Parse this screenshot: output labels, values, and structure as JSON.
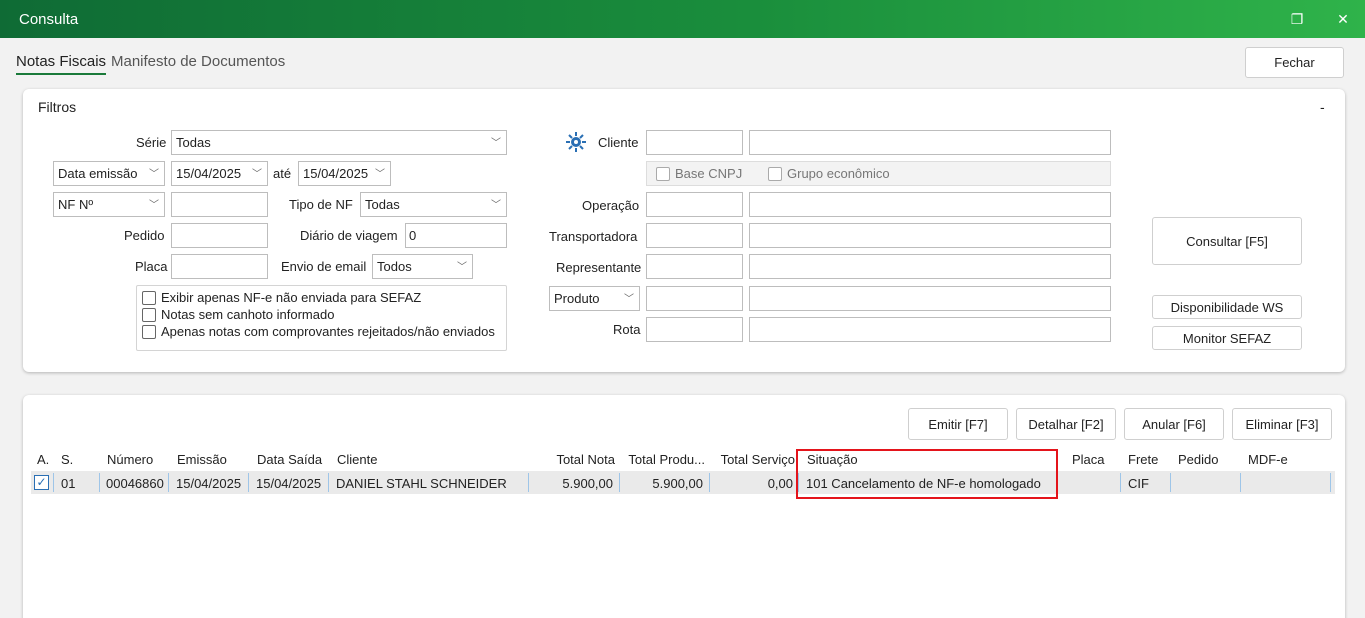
{
  "window": {
    "title": "Consulta",
    "restore_glyph": "❐",
    "close_glyph": "✕"
  },
  "tabs": [
    {
      "label": "Notas Fiscais",
      "active": true
    },
    {
      "label": "Manifesto de Documentos",
      "active": false
    }
  ],
  "header": {
    "close_button": "Fechar"
  },
  "filters": {
    "title": "Filtros",
    "collapse_glyph": "-",
    "serie": {
      "label": "Série",
      "value": "Todas"
    },
    "date_type": {
      "value": "Data emissão"
    },
    "date_from": {
      "value": "15/04/2025"
    },
    "ate_label": "até",
    "date_to": {
      "value": "15/04/2025"
    },
    "nf_type": {
      "value": "NF Nº"
    },
    "nf_number": {
      "value": ""
    },
    "tipo_nf": {
      "label": "Tipo de NF",
      "value": "Todas"
    },
    "pedido": {
      "label": "Pedido",
      "value": ""
    },
    "diario": {
      "label": "Diário de viagem",
      "value": "0"
    },
    "placa": {
      "label": "Placa",
      "value": ""
    },
    "envio_email": {
      "label": "Envio de email",
      "value": "Todos"
    },
    "checkboxes": [
      {
        "label": "Exibir apenas NF-e não enviada para SEFAZ",
        "checked": false
      },
      {
        "label": "Notas sem canhoto informado",
        "checked": false
      },
      {
        "label": "Apenas notas com comprovantes rejeitados/não enviados",
        "checked": false
      }
    ],
    "cliente": {
      "label": "Cliente",
      "code": "",
      "name": ""
    },
    "base_cnpj": "Base CNPJ",
    "grupo_economico": "Grupo econômico",
    "operacao": {
      "label": "Operação"
    },
    "transportadora": {
      "label": "Transportadora"
    },
    "representante": {
      "label": "Representante"
    },
    "produto": {
      "value": "Produto"
    },
    "rota": {
      "label": "Rota"
    },
    "consultar_button": "Consultar [F5]",
    "disponibilidade_button": "Disponibilidade WS",
    "monitor_button": "Monitor SEFAZ"
  },
  "actions": {
    "emitir": "Emitir [F7]",
    "detalhar": "Detalhar [F2]",
    "anular": "Anular [F6]",
    "eliminar": "Eliminar [F3]"
  },
  "grid": {
    "columns": [
      "A.",
      "S.",
      "Número",
      "Emissão",
      "Data Saída",
      "Cliente",
      "Total Nota",
      "Total Produ...",
      "Total Serviço",
      "Situação",
      "Placa",
      "Frete",
      "Pedido",
      "MDF-e"
    ],
    "rows": [
      {
        "checked": true,
        "serie": "01",
        "numero": "00046860",
        "emissao": "15/04/2025",
        "data_saida": "15/04/2025",
        "cliente": "DANIEL STAHL SCHNEIDER",
        "total_nota": "5.900,00",
        "total_produtos": "5.900,00",
        "total_servico": "0,00",
        "situacao": "101 Cancelamento de NF-e homologado",
        "placa": "",
        "frete": "CIF",
        "pedido": "",
        "mdfe": ""
      }
    ]
  },
  "colors": {
    "title_gradient_start": "#0f6b35",
    "title_gradient_end": "#2fb34a",
    "highlight": "#e4141b"
  }
}
